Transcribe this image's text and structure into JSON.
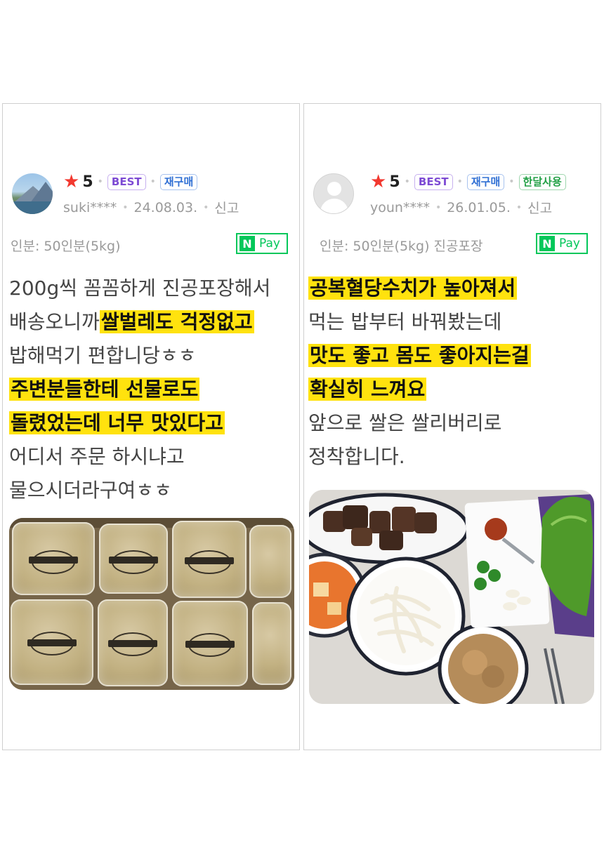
{
  "reviews": [
    {
      "rating_star": "★",
      "rating": "5",
      "badges": [
        "BEST",
        "재구매"
      ],
      "user": "suki****",
      "date": "24.08.03.",
      "report": "신고",
      "option": "인분: 50인분(5kg)",
      "pay_mark": "N",
      "pay_label": "Pay",
      "lines": [
        {
          "parts": [
            "200g씩 꼼꼼하게 진공포장해서"
          ]
        },
        {
          "parts": [
            "배송오니까",
            "쌀벌레도 걱정없고"
          ]
        },
        {
          "parts": [
            "밥해먹기 편합니당ㅎㅎ"
          ]
        },
        {
          "parts": [
            "주변분들한테 선물로도"
          ]
        },
        {
          "parts": [
            "돌렸었는데 너무 맛있다고"
          ]
        },
        {
          "parts": [
            "어디서 주문 하시냐고"
          ]
        },
        {
          "parts": [
            "물으시더라구여ㅎㅎ"
          ]
        }
      ],
      "photo": "vacuum-packed-rice-photo"
    },
    {
      "rating_star": "★",
      "rating": "5",
      "badges": [
        "BEST",
        "재구매",
        "한달사용"
      ],
      "user": "youn****",
      "date": "26.01.05.",
      "report": "신고",
      "option": "인분: 50인분(5kg) 진공포장",
      "pay_mark": "N",
      "pay_label": "Pay",
      "lines": [
        {
          "parts": [
            "공복혈당수치가 높아져서"
          ]
        },
        {
          "parts": [
            "먹는 밥부터 바꿔봤는데"
          ]
        },
        {
          "parts": [
            "맛도 좋고 몸도 좋아지는걸"
          ]
        },
        {
          "parts": [
            "확실히 느껴요"
          ]
        },
        {
          "parts": [
            "앞으로 쌀은 쌀리버리로"
          ]
        },
        {
          "parts": [
            "정착합니다."
          ]
        }
      ],
      "photo": "korean-meal-photo"
    }
  ],
  "colors": {
    "highlight": "#ffe20e",
    "star": "#f2382f",
    "best_badge": "#7d4ad4",
    "rebuy_badge": "#2f6fd4",
    "month_badge": "#22a045",
    "naver_pay": "#03c75a",
    "meta_text": "#9a9a9a"
  }
}
